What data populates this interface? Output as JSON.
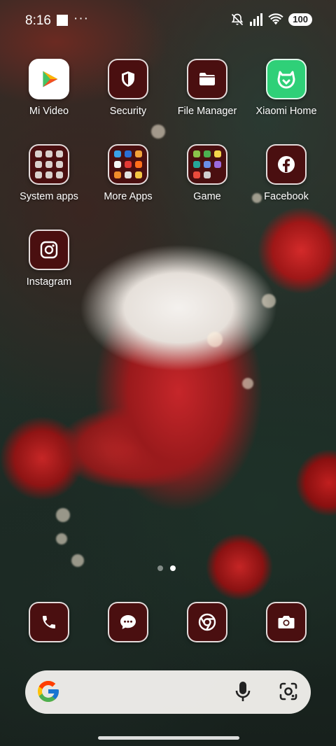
{
  "status_bar": {
    "time": "8:16",
    "overflow": "···",
    "battery": "100",
    "icons": [
      "notification-square-icon",
      "mute-icon",
      "signal-icon",
      "wifi-icon",
      "battery-icon"
    ]
  },
  "apps": [
    {
      "label": "Mi Video",
      "icon": "mi-video-icon"
    },
    {
      "label": "Security",
      "icon": "shield-icon"
    },
    {
      "label": "File Manager",
      "icon": "folder-icon"
    },
    {
      "label": "Xiaomi Home",
      "icon": "mi-home-icon"
    },
    {
      "label": "System apps",
      "icon": "folder-grid-icon"
    },
    {
      "label": "More Apps",
      "icon": "folder-grid-icon"
    },
    {
      "label": "Game",
      "icon": "folder-grid-icon"
    },
    {
      "label": "Facebook",
      "icon": "facebook-icon"
    },
    {
      "label": "Instagram",
      "icon": "instagram-icon"
    }
  ],
  "pager": {
    "pages": 2,
    "current": 2
  },
  "dock": [
    {
      "name": "Phone",
      "icon": "phone-icon"
    },
    {
      "name": "Messages",
      "icon": "message-icon"
    },
    {
      "name": "Chrome",
      "icon": "chrome-icon"
    },
    {
      "name": "Camera",
      "icon": "camera-icon"
    }
  ],
  "search": {
    "icons": [
      "google-g-icon",
      "mic-icon",
      "lens-icon"
    ]
  },
  "colors": {
    "tile": "#4a0f10",
    "accent": "#ffffff"
  }
}
